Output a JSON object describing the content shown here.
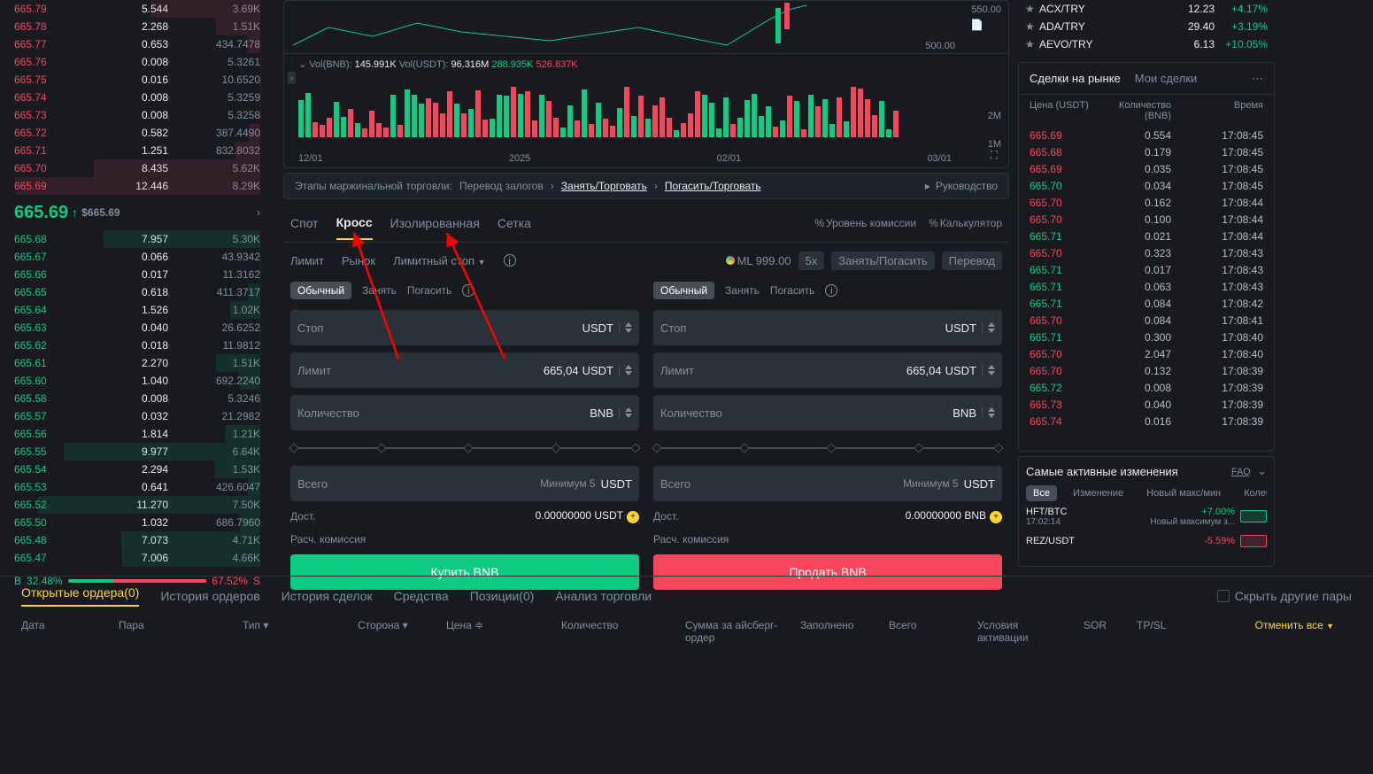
{
  "orderbook": {
    "asks": [
      {
        "p": "665.79",
        "q": "5.544",
        "t": "3.69K"
      },
      {
        "p": "665.78",
        "q": "2.268",
        "t": "1.51K"
      },
      {
        "p": "665.77",
        "q": "0.653",
        "t": "434.7478"
      },
      {
        "p": "665.76",
        "q": "0.008",
        "t": "5.3261"
      },
      {
        "p": "665.75",
        "q": "0.016",
        "t": "10.6520"
      },
      {
        "p": "665.74",
        "q": "0.008",
        "t": "5.3259"
      },
      {
        "p": "665.73",
        "q": "0.008",
        "t": "5.3258"
      },
      {
        "p": "665.72",
        "q": "0.582",
        "t": "387.4490"
      },
      {
        "p": "665.71",
        "q": "1.251",
        "t": "832.8032"
      },
      {
        "p": "665.70",
        "q": "8.435",
        "t": "5.62K"
      },
      {
        "p": "665.69",
        "q": "12.446",
        "t": "8.29K"
      }
    ],
    "bids": [
      {
        "p": "665.68",
        "q": "7.957",
        "t": "5.30K"
      },
      {
        "p": "665.67",
        "q": "0.066",
        "t": "43.9342"
      },
      {
        "p": "665.66",
        "q": "0.017",
        "t": "11.3162"
      },
      {
        "p": "665.65",
        "q": "0.618",
        "t": "411.3717"
      },
      {
        "p": "665.64",
        "q": "1.526",
        "t": "1.02K"
      },
      {
        "p": "665.63",
        "q": "0.040",
        "t": "26.6252"
      },
      {
        "p": "665.62",
        "q": "0.018",
        "t": "11.9812"
      },
      {
        "p": "665.61",
        "q": "2.270",
        "t": "1.51K"
      },
      {
        "p": "665.60",
        "q": "1.040",
        "t": "692.2240"
      },
      {
        "p": "665.58",
        "q": "0.008",
        "t": "5.3246"
      },
      {
        "p": "665.57",
        "q": "0.032",
        "t": "21.2982"
      },
      {
        "p": "665.56",
        "q": "1.814",
        "t": "1.21K"
      },
      {
        "p": "665.55",
        "q": "9.977",
        "t": "6.64K"
      },
      {
        "p": "665.54",
        "q": "2.294",
        "t": "1.53K"
      },
      {
        "p": "665.53",
        "q": "0.641",
        "t": "426.6047"
      },
      {
        "p": "665.52",
        "q": "11.270",
        "t": "7.50K"
      },
      {
        "p": "665.50",
        "q": "1.032",
        "t": "686.7960"
      },
      {
        "p": "665.48",
        "q": "7.073",
        "t": "4.71K"
      },
      {
        "p": "665.47",
        "q": "7.006",
        "t": "4.66K"
      }
    ],
    "mid_price": "665.69",
    "mid_sub": "$665.69",
    "buy_pct": "32.48%",
    "sell_pct": "67.52%",
    "buy_label": "B",
    "sell_label": "S"
  },
  "chart": {
    "price_high": "550.00",
    "price_low": "500.00",
    "vol_label": "Vol(BNB):",
    "vol_bnb": "145.991K",
    "vol_usdt_label": "Vol(USDT):",
    "vol_usdt": "96.316M",
    "vol_extra1": "288.935K",
    "vol_extra2": "526.837K",
    "y2_a": "2M",
    "y2_b": "1M",
    "dates": [
      "12/01",
      "2025",
      "02/01",
      "03/01"
    ]
  },
  "margin_steps": {
    "title": "Этапы маржинальной торговли:",
    "step1": "Перевод залогов",
    "step2": "Занять/Торговать",
    "step3": "Погасить/Торговать",
    "guide": "Руководство"
  },
  "trade": {
    "modes": [
      "Спот",
      "Кросс",
      "Изолированная",
      "Сетка"
    ],
    "mode_active": "Кросс",
    "tools": {
      "comm": "Уровень комиссии",
      "calc": "Калькулятор"
    },
    "order_types": [
      "Лимит",
      "Рынок",
      "Лимитный стоп"
    ],
    "order_type_active": "Лимитный стоп",
    "ml_label": "ML 999.00",
    "leverage": "5x",
    "actions": {
      "borrow": "Занять/Погасить",
      "transfer": "Перевод"
    },
    "sub_modes": [
      "Обычный",
      "Занять",
      "Погасить"
    ],
    "sub_active": "Обычный",
    "fields": {
      "stop": "Стоп",
      "limit": "Лимит",
      "limit_val": "665,04",
      "qty": "Количество",
      "total": "Всего",
      "min_hint": "Минимум 5"
    },
    "units": {
      "usdt": "USDT",
      "bnb": "BNB"
    },
    "info": {
      "avail": "Дост.",
      "buy_bal": "0.00000000 USDT",
      "sell_bal": "0.00000000 BNB",
      "fee": "Расч. комиссия"
    },
    "buy_btn": "Купить BNB",
    "sell_btn": "Продать BNB"
  },
  "watchlist": [
    {
      "pair": "ACX/TRY",
      "price": "12.23",
      "chg": "+4.17%"
    },
    {
      "pair": "ADA/TRY",
      "price": "29.40",
      "chg": "+3.19%"
    },
    {
      "pair": "AEVO/TRY",
      "price": "6.13",
      "chg": "+10.05%"
    }
  ],
  "trades": {
    "tab1": "Сделки на рынке",
    "tab2": "Мои сделки",
    "head_price": "Цена (USDT)",
    "head_qty": "Количество (BNB)",
    "head_time": "Время",
    "rows": [
      {
        "p": "665.69",
        "q": "0.554",
        "t": "17:08:45",
        "c": "red"
      },
      {
        "p": "665.68",
        "q": "0.179",
        "t": "17:08:45",
        "c": "red"
      },
      {
        "p": "665.69",
        "q": "0.035",
        "t": "17:08:45",
        "c": "red"
      },
      {
        "p": "665.70",
        "q": "0.034",
        "t": "17:08:45",
        "c": "green"
      },
      {
        "p": "665.70",
        "q": "0.162",
        "t": "17:08:44",
        "c": "red"
      },
      {
        "p": "665.70",
        "q": "0.100",
        "t": "17:08:44",
        "c": "red"
      },
      {
        "p": "665.71",
        "q": "0.021",
        "t": "17:08:44",
        "c": "green"
      },
      {
        "p": "665.70",
        "q": "0.323",
        "t": "17:08:43",
        "c": "red"
      },
      {
        "p": "665.71",
        "q": "0.017",
        "t": "17:08:43",
        "c": "green"
      },
      {
        "p": "665.71",
        "q": "0.063",
        "t": "17:08:43",
        "c": "green"
      },
      {
        "p": "665.71",
        "q": "0.084",
        "t": "17:08:42",
        "c": "green"
      },
      {
        "p": "665.70",
        "q": "0.084",
        "t": "17:08:41",
        "c": "red"
      },
      {
        "p": "665.71",
        "q": "0.300",
        "t": "17:08:40",
        "c": "green"
      },
      {
        "p": "665.70",
        "q": "2.047",
        "t": "17:08:40",
        "c": "red"
      },
      {
        "p": "665.70",
        "q": "0.132",
        "t": "17:08:39",
        "c": "red"
      },
      {
        "p": "665.72",
        "q": "0.008",
        "t": "17:08:39",
        "c": "green"
      },
      {
        "p": "665.73",
        "q": "0.040",
        "t": "17:08:39",
        "c": "red"
      },
      {
        "p": "665.74",
        "q": "0.016",
        "t": "17:08:39",
        "c": "red"
      }
    ]
  },
  "movers": {
    "title": "Самые активные изменения",
    "faq": "FAQ",
    "tabs": [
      "Все",
      "Изменение",
      "Новый макс/мин",
      "Колеб"
    ],
    "tab_active": "Все",
    "rows": [
      {
        "pair": "HFT/BTC",
        "time": "17:02:14",
        "chg": "+7.00%",
        "desc": "Новый максимум з...",
        "c": "green"
      },
      {
        "pair": "REZ/USDT",
        "time": "",
        "chg": "-5.59%",
        "desc": "",
        "c": "red"
      }
    ]
  },
  "orders": {
    "tabs": [
      "Открытые ордера(0)",
      "История ордеров",
      "История сделок",
      "Средства",
      "Позиции(0)",
      "Анализ торговли"
    ],
    "tab_active": "Открытые ордера(0)",
    "hide_pairs": "Скрыть другие пары",
    "cols": [
      "Дата",
      "Пара",
      "Тип",
      "Сторона",
      "Цена",
      "Количество",
      "Сумма за айсберг-ордер",
      "Заполнено",
      "Всего",
      "Условия активации",
      "SOR",
      "TP/SL"
    ],
    "cancel_all": "Отменить все"
  }
}
